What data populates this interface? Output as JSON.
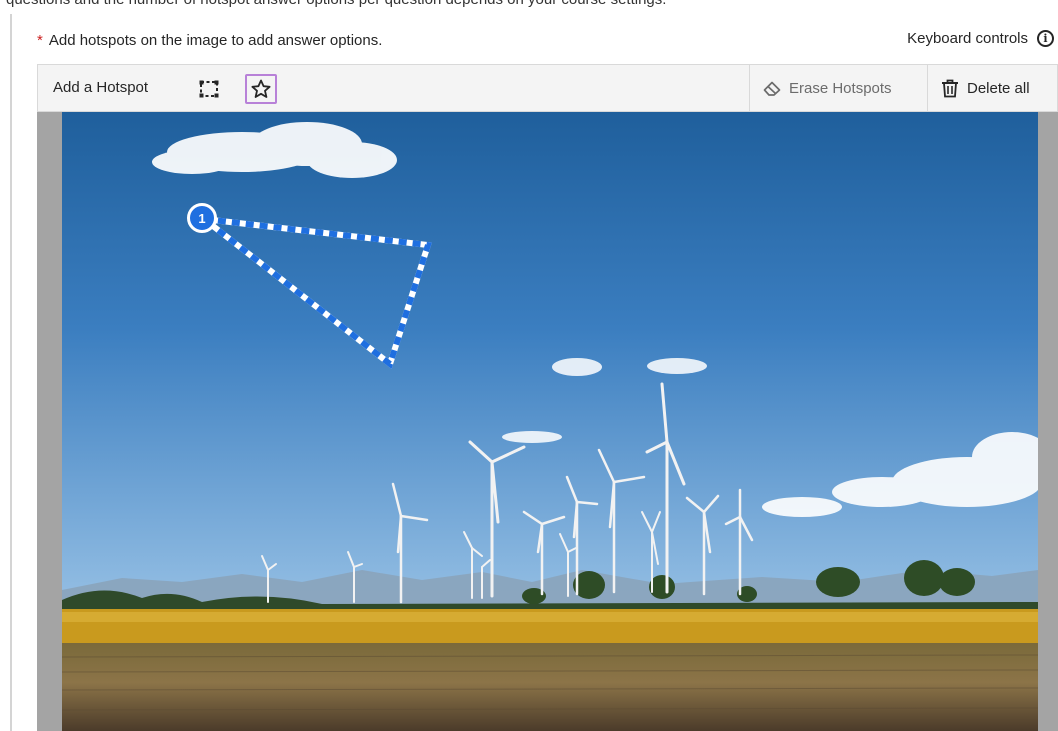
{
  "prompt_cutoff": "questions and the number of hotspot answer options per question depends on your course settings.",
  "instructions": {
    "required_marker": "*",
    "text": "Add hotspots on the image to add answer options.",
    "keyboard_controls": "Keyboard controls"
  },
  "toolbar": {
    "add_hotspot_label": "Add a Hotspot",
    "erase_label": "Erase Hotspots",
    "delete_label": "Delete all"
  },
  "hotspots": [
    {
      "number": "1",
      "shape": "polygon"
    }
  ],
  "icons": {
    "rectangle_tool": "rectangle-select-icon",
    "polygon_tool": "polygon-star-icon",
    "erase": "eraser-icon",
    "delete": "trash-icon",
    "info": "info-icon"
  },
  "colors": {
    "required": "#cc1f1f",
    "hotspot": "#1f6fe0",
    "active_tool_border": "#b881d8"
  }
}
